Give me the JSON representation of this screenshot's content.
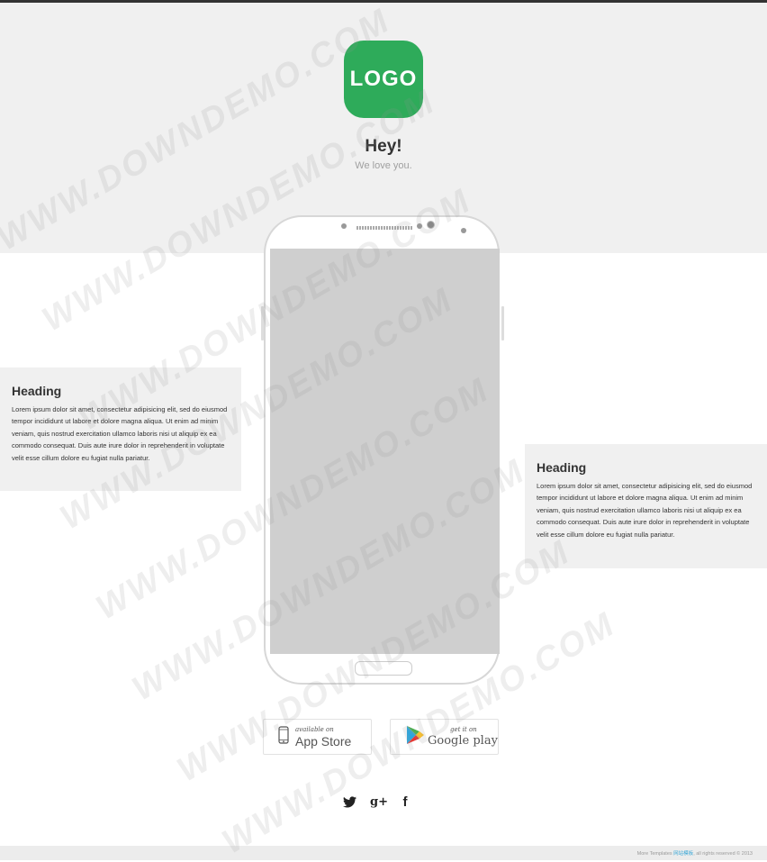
{
  "brand": {
    "logo_text": "LOGO",
    "logo_color": "#2eab5a"
  },
  "hero": {
    "title": "Hey!",
    "subtitle": "We love you."
  },
  "features": [
    {
      "heading": "Heading",
      "body": "Lorem ipsum dolor sit amet, consectetur adipisicing elit, sed do eiusmod tempor incididunt ut labore et dolore magna aliqua. Ut enim ad minim veniam, quis nostrud exercitation ullamco laboris nisi ut aliquip ex ea commodo consequat. Duis aute irure dolor in reprehenderit in voluptate velit esse cillum dolore eu fugiat nulla pariatur."
    },
    {
      "heading": "Heading",
      "body": "Lorem ipsum dolor sit amet, consectetur adipisicing elit, sed do eiusmod tempor incididunt ut labore et dolore magna aliqua. Ut enim ad minim veniam, quis nostrud exercitation ullamco laboris nisi ut aliquip ex ea commodo consequat. Duis aute irure dolor in reprehenderit in voluptate velit esse cillum dolore eu fugiat nulla pariatur."
    }
  ],
  "stores": {
    "apple": {
      "small": "available on",
      "big": "App Store",
      "icon": "phone-icon"
    },
    "google": {
      "small": "get it on",
      "big": "Google play",
      "icon": "google-play-icon"
    }
  },
  "social": [
    {
      "name": "twitter",
      "glyph": "twitter-icon"
    },
    {
      "name": "google-plus",
      "glyph": "google-plus-icon",
      "label": "g+"
    },
    {
      "name": "facebook",
      "glyph": "facebook-icon",
      "label": "f"
    }
  ],
  "footer": {
    "prefix": "More Templates ",
    "accent": "网站模板",
    "suffix": ", all rights reserved © 2013"
  },
  "watermark": "WWW.DOWNDEMO.COM",
  "colors": {
    "accent": "#2eab5a",
    "hero_bg": "#f0f0f0",
    "screen": "#cfcfcf",
    "footer_link": "#3aa7d6"
  }
}
